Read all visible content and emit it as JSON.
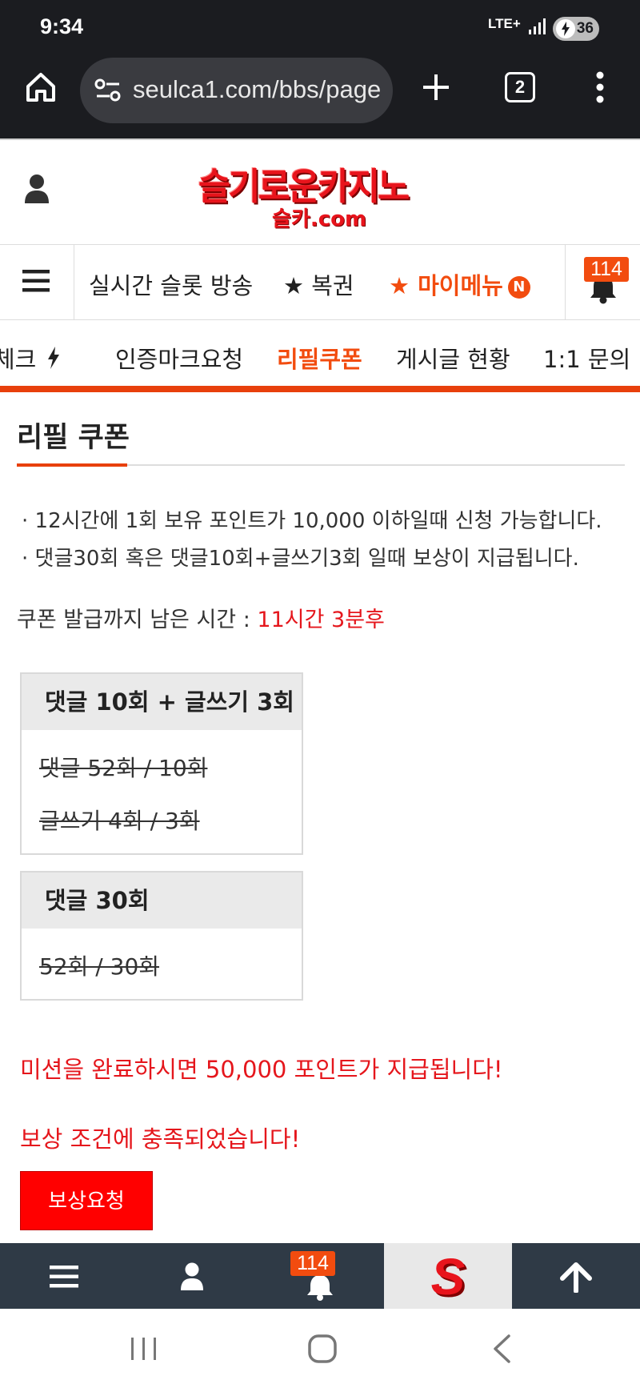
{
  "status_bar": {
    "time": "9:34",
    "network": "LTE+",
    "battery": "36"
  },
  "browser": {
    "url": "seulca1.com/bbs/page",
    "tab_count": "2"
  },
  "site": {
    "logo_main": "슬기로운카지노",
    "logo_sub": "슬카.com"
  },
  "main_nav": {
    "items": [
      "실시간 슬롯 방송",
      "★ 복권",
      "★ 마이메뉴"
    ],
    "new_badge": "N",
    "bell_count": "114"
  },
  "sub_nav": {
    "items": [
      "체크",
      "인증마크요청",
      "리필쿠폰",
      "게시글 현황",
      "1:1 문의"
    ]
  },
  "page": {
    "title": "리필 쿠폰",
    "rules": [
      "· 12시간에 1회 보유 포인트가 10,000 이하일때 신청 가능합니다.",
      "· 댓글30회 혹은 댓글10회+글쓰기3회 일때 보상이 지급됩니다."
    ],
    "timer_label": "쿠폰 발급까지 남은 시간 : ",
    "timer_value": "11시간 3분후",
    "missions": [
      {
        "title": "댓글 10회 + 글쓰기 3회",
        "rows": [
          "댓글 52회 / 10회",
          "글쓰기 4회 / 3회"
        ]
      },
      {
        "title": "댓글 30회",
        "rows": [
          "52회 / 30회"
        ]
      }
    ],
    "mission_notice": "미션을 완료하시면 50,000 포인트가 지급됩니다!",
    "condition_notice": "보상 조건에 충족되었습니다!",
    "claim_button": "보상요청"
  },
  "bottom_nav": {
    "bell_count": "114",
    "logo_letter": "S"
  },
  "colors": {
    "accent": "#e8400c",
    "red": "#e5161c",
    "button": "#ff0000",
    "bottom_bar": "#2f3a46",
    "browser_bar": "#1b1c20"
  }
}
